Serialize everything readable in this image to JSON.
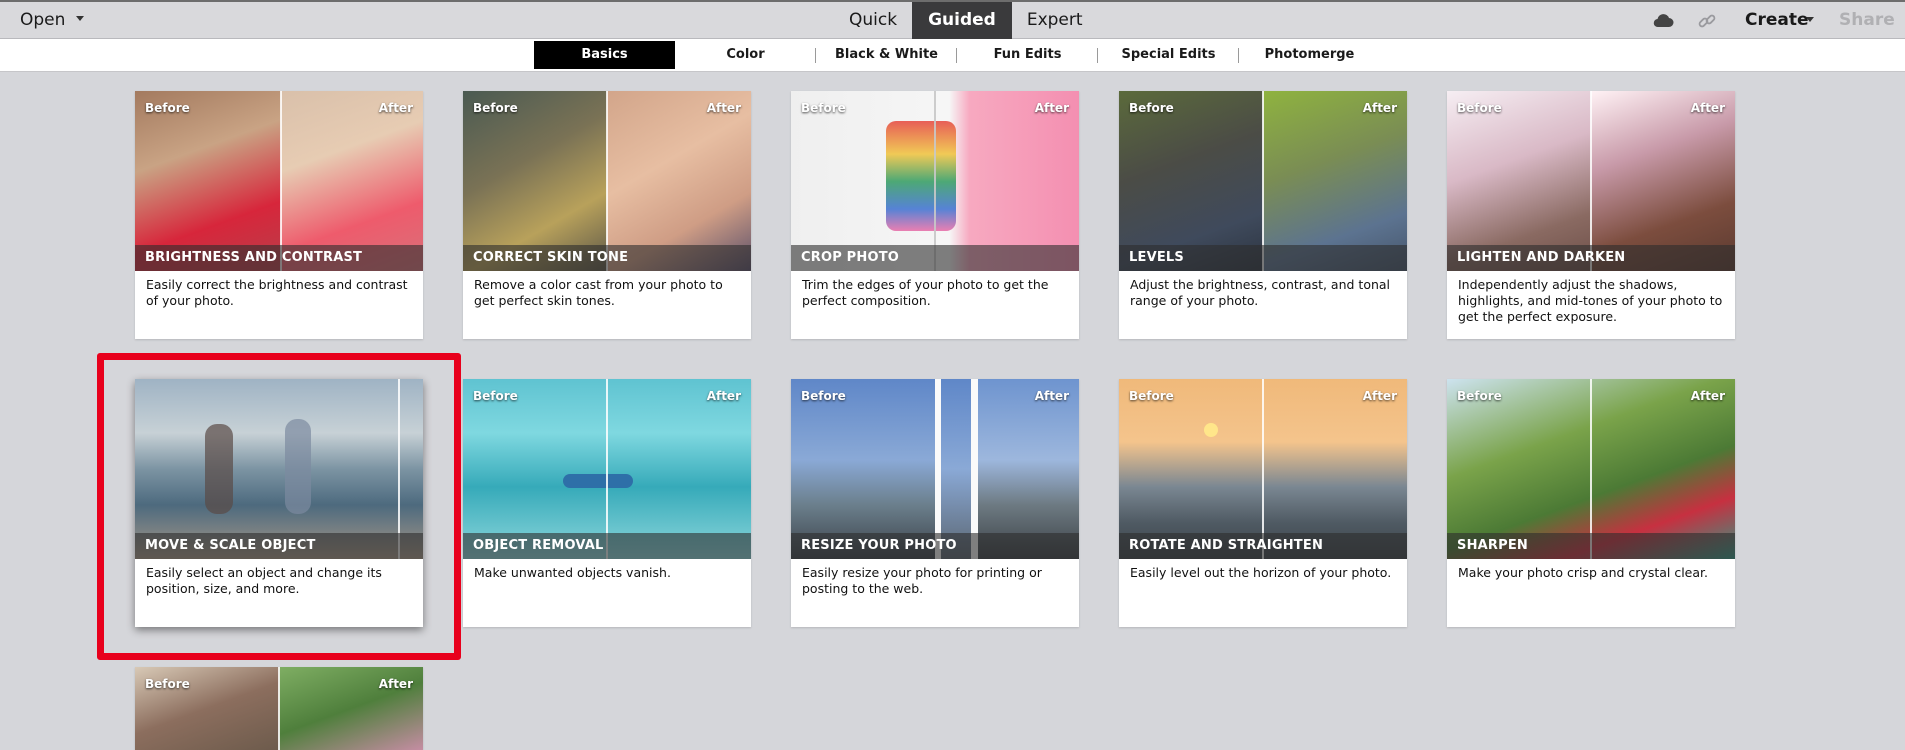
{
  "topbar": {
    "open_label": "Open",
    "modes": [
      "Quick",
      "Guided",
      "Expert"
    ],
    "active_mode": "Guided",
    "cloud_icon": "cloud-icon",
    "link_icon": "link-icon",
    "create_label": "Create",
    "share_label": "Share"
  },
  "subtabs": [
    "Basics",
    "Color",
    "Black & White",
    "Fun Edits",
    "Special Edits",
    "Photomerge"
  ],
  "active_subtab": "Basics",
  "labels": {
    "before": "Before",
    "after": "After"
  },
  "cards": [
    {
      "title": "BRIGHTNESS AND CONTRAST",
      "desc": "Easily correct the brightness and contrast of your photo.",
      "show_labels": true
    },
    {
      "title": "CORRECT SKIN TONE",
      "desc": "Remove a color cast from your photo to get perfect skin tones.",
      "show_labels": true
    },
    {
      "title": "CROP PHOTO",
      "desc": "Trim the edges of your photo to get the perfect composition.",
      "show_labels": true
    },
    {
      "title": "LEVELS",
      "desc": "Adjust the brightness, contrast, and tonal range of your photo.",
      "show_labels": true
    },
    {
      "title": "LIGHTEN AND DARKEN",
      "desc": "Independently adjust the shadows, highlights, and mid-tones of your photo to get the perfect exposure.",
      "show_labels": true
    },
    {
      "title": "MOVE & SCALE OBJECT",
      "desc": "Easily select an object and change its position, size, and more.",
      "show_labels": false
    },
    {
      "title": "OBJECT REMOVAL",
      "desc": "Make unwanted objects vanish.",
      "show_labels": true
    },
    {
      "title": "RESIZE YOUR PHOTO",
      "desc": "Easily resize your photo for printing or posting to the web.",
      "show_labels": true
    },
    {
      "title": "ROTATE AND STRAIGHTEN",
      "desc": "Easily level out the horizon of your photo.",
      "show_labels": true
    },
    {
      "title": "SHARPEN",
      "desc": "Make your photo crisp and crystal clear.",
      "show_labels": true
    },
    {
      "title": "",
      "desc": "",
      "show_labels": true
    }
  ],
  "colors": {
    "highlight": "#e8001c",
    "active_tab_bg": "#3a3a3c",
    "active_subtab_bg": "#000000"
  }
}
